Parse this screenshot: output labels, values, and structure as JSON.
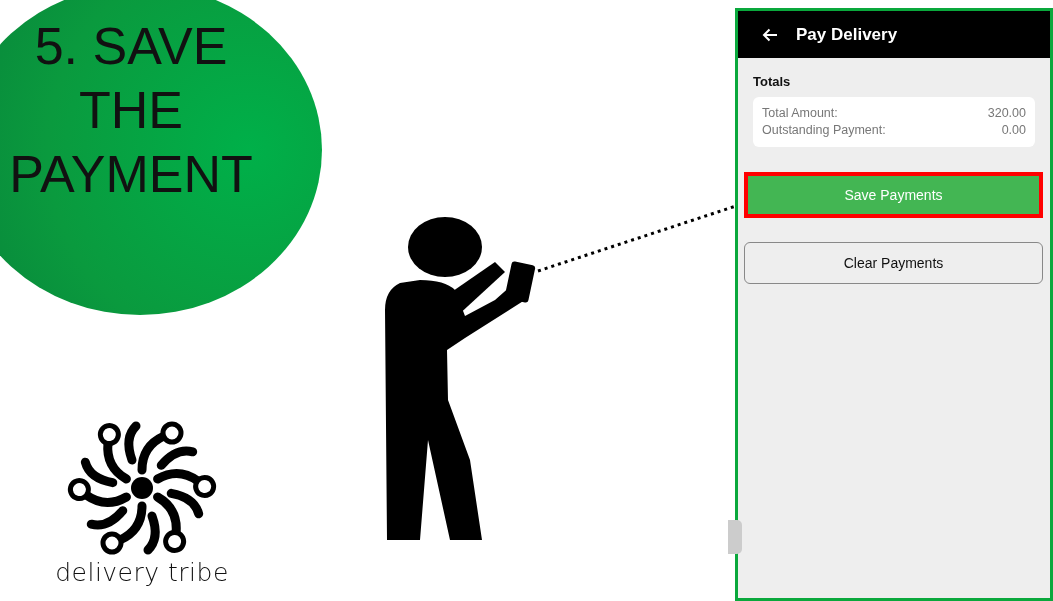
{
  "slide": {
    "heading": "5. SAVE THE PAYMENT",
    "brand": "delivery tribe"
  },
  "app": {
    "title": "Pay Delivery",
    "section": "Totals",
    "totals": [
      {
        "label": "Total Amount:",
        "value": "320.00"
      },
      {
        "label": "Outstanding Payment:",
        "value": "0.00"
      }
    ],
    "buttons": [
      {
        "label": "Save Payments",
        "kind": "primary",
        "highlighted": true
      },
      {
        "label": "Clear Payments",
        "kind": "secondary",
        "highlighted": false
      }
    ]
  }
}
